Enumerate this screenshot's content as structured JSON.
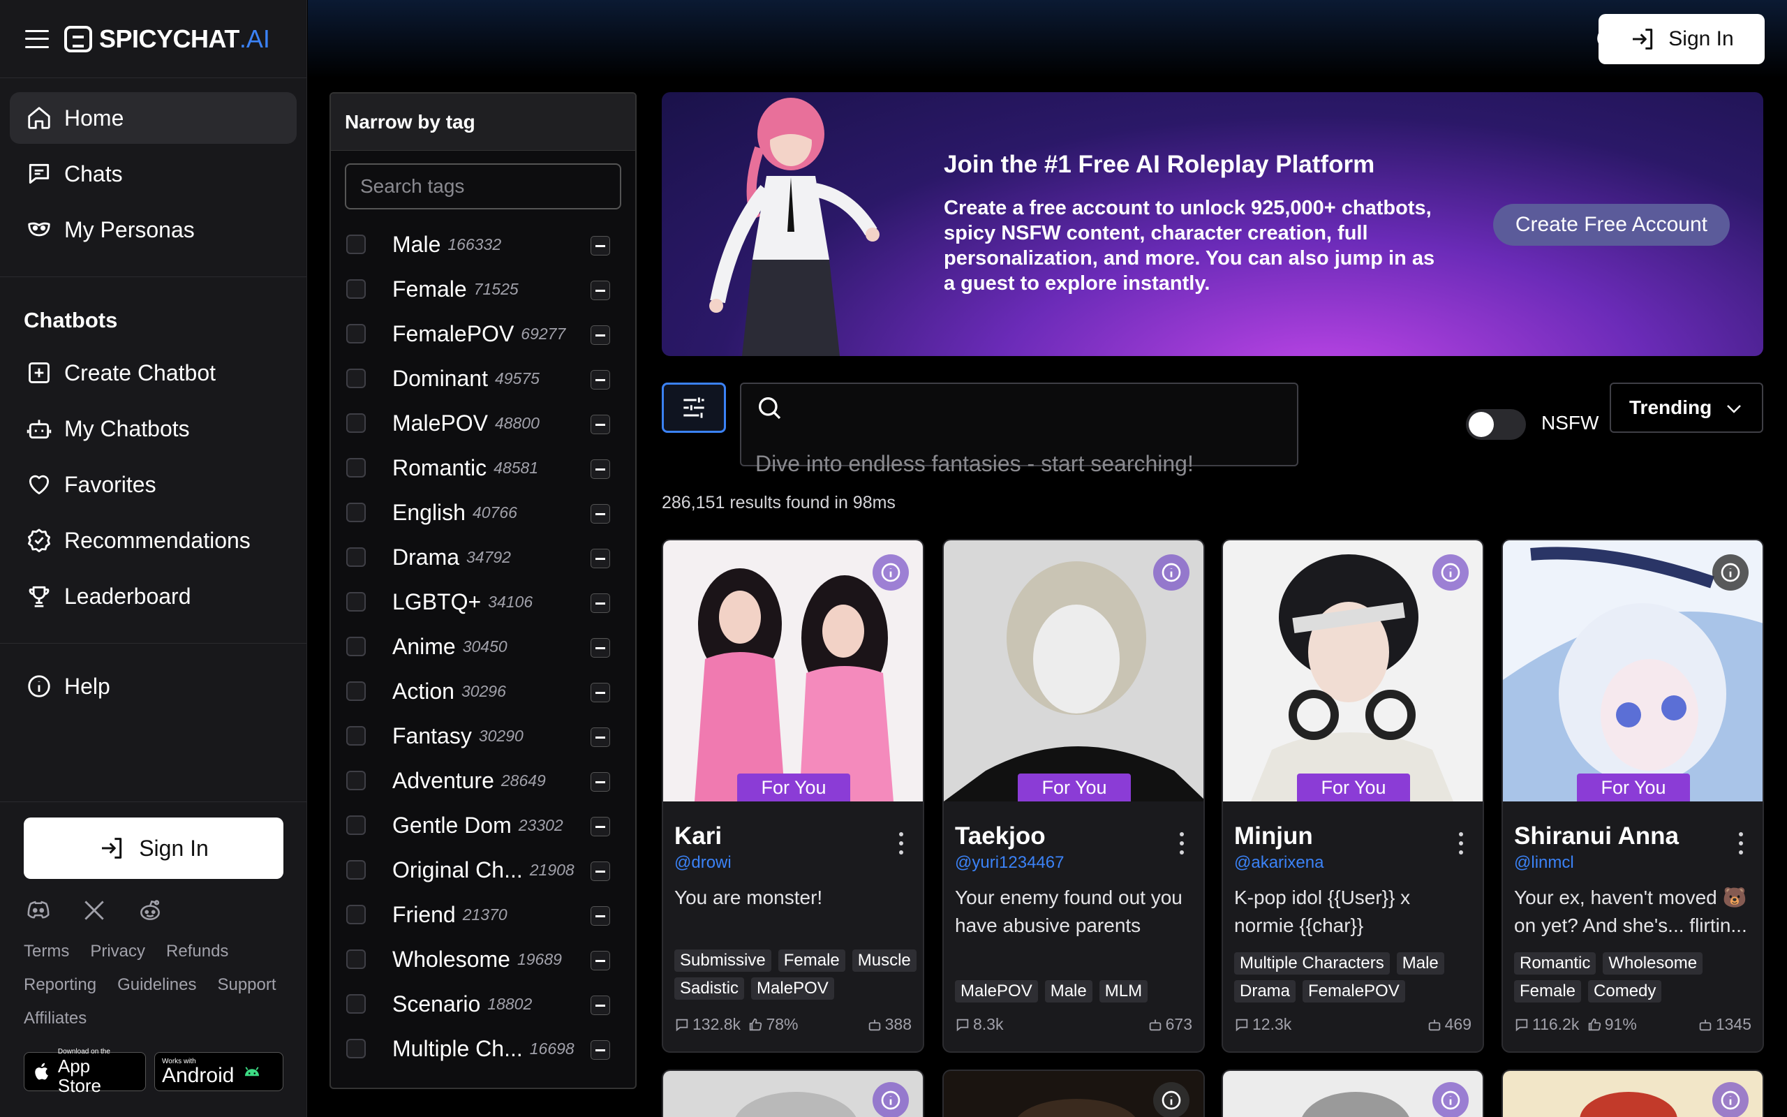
{
  "brand": {
    "name": "SPICYCHAT",
    "suffix": ".AI"
  },
  "nav": {
    "main": [
      {
        "label": "Home",
        "icon": "home-icon"
      },
      {
        "label": "Chats",
        "icon": "chat-icon"
      },
      {
        "label": "My Personas",
        "icon": "mask-icon"
      }
    ],
    "chatbots_title": "Chatbots",
    "chatbots": [
      {
        "label": "Create Chatbot",
        "icon": "plus-square-icon"
      },
      {
        "label": "My Chatbots",
        "icon": "bot-icon"
      },
      {
        "label": "Favorites",
        "icon": "heart-icon"
      },
      {
        "label": "Recommendations",
        "icon": "badge-check-icon"
      },
      {
        "label": "Leaderboard",
        "icon": "trophy-icon"
      }
    ],
    "help": "Help"
  },
  "sidebar_bottom": {
    "sign_in": "Sign In",
    "links": [
      "Terms",
      "Privacy",
      "Refunds",
      "Reporting",
      "Guidelines",
      "Support",
      "Affiliates"
    ],
    "app_store": {
      "small": "Download on the",
      "big": "App Store"
    },
    "android": {
      "small": "Works with",
      "big": "Android"
    }
  },
  "topbar": {
    "sign_in": "Sign In"
  },
  "tags": {
    "title": "Narrow by tag",
    "search_placeholder": "Search tags",
    "items": [
      {
        "name": "Male",
        "count": "166332"
      },
      {
        "name": "Female",
        "count": "71525"
      },
      {
        "name": "FemalePOV",
        "count": "69277"
      },
      {
        "name": "Dominant",
        "count": "49575"
      },
      {
        "name": "MalePOV",
        "count": "48800"
      },
      {
        "name": "Romantic",
        "count": "48581"
      },
      {
        "name": "English",
        "count": "40766"
      },
      {
        "name": "Drama",
        "count": "34792"
      },
      {
        "name": "LGBTQ+",
        "count": "34106"
      },
      {
        "name": "Anime",
        "count": "30450"
      },
      {
        "name": "Action",
        "count": "30296"
      },
      {
        "name": "Fantasy",
        "count": "30290"
      },
      {
        "name": "Adventure",
        "count": "28649"
      },
      {
        "name": "Gentle Dom",
        "count": "23302"
      },
      {
        "name": "Original Ch...",
        "count": "21908"
      },
      {
        "name": "Friend",
        "count": "21370"
      },
      {
        "name": "Wholesome",
        "count": "19689"
      },
      {
        "name": "Scenario",
        "count": "18802"
      },
      {
        "name": "Multiple Ch...",
        "count": "16698"
      }
    ]
  },
  "banner": {
    "title": "Join the #1 Free AI Roleplay Platform",
    "text": "Create a free account to unlock 925,000+ chatbots, spicy NSFW content, character creation, full personalization, and more. You can also jump in as a guest to explore instantly.",
    "cta": "Create Free Account"
  },
  "search": {
    "placeholder": "Dive into endless fantasies - start searching!",
    "nsfw_label": "NSFW",
    "sort": "Trending",
    "results": "286,151 results found in 98ms"
  },
  "cards": [
    {
      "name": "Kari",
      "handle": "@drowi",
      "badge": "For You",
      "desc": "You are monster!",
      "tags": [
        "Submissive",
        "Female",
        "Muscle",
        "Sadistic",
        "MalePOV"
      ],
      "messages": "132.8k",
      "likes": "78%",
      "bots": "388"
    },
    {
      "name": "Taekjoo",
      "handle": "@yuri1234467",
      "badge": "For You",
      "desc": "Your enemy found out you have abusive parents",
      "tags": [
        "MalePOV",
        "Male",
        "MLM"
      ],
      "messages": "8.3k",
      "likes": "",
      "bots": "673"
    },
    {
      "name": "Minjun",
      "handle": "@akarixena",
      "badge": "For You",
      "desc": "K-pop idol {{User}} x normie {{char}}",
      "tags": [
        "Multiple Characters",
        "Male",
        "Drama",
        "FemalePOV"
      ],
      "messages": "12.3k",
      "likes": "",
      "bots": "469"
    },
    {
      "name": "Shiranui Anna",
      "handle": "@linmcl",
      "badge": "For You",
      "desc": "Your ex, haven't moved 🐻 on yet? And she's... flirtin...",
      "tags": [
        "Romantic",
        "Wholesome",
        "Female",
        "Comedy"
      ],
      "messages": "116.2k",
      "likes": "91%",
      "bots": "1345"
    }
  ]
}
